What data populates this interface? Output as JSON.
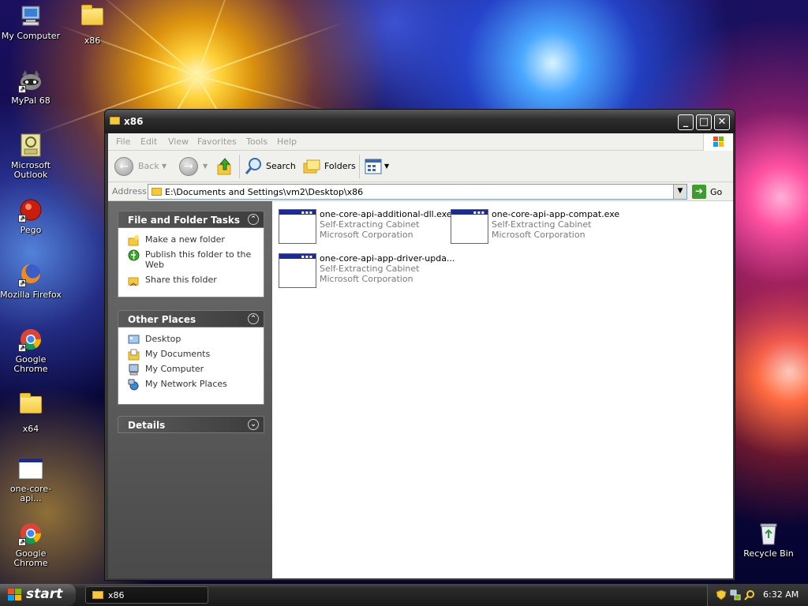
{
  "desktop": {
    "icons": [
      {
        "label": "My Computer"
      },
      {
        "label": "x86"
      },
      {
        "label": "MyPal 68"
      },
      {
        "label": "Microsoft Outlook"
      },
      {
        "label": "Pego"
      },
      {
        "label": "Mozilla Firefox"
      },
      {
        "label": "Google Chrome"
      },
      {
        "label": "x64"
      },
      {
        "label": "one-core-api..."
      },
      {
        "label": "Google Chrome"
      },
      {
        "label": "Recycle Bin"
      }
    ]
  },
  "window": {
    "title": "x86",
    "controls": {
      "minimize": "_",
      "maximize": "□",
      "close": "✕"
    },
    "menu": [
      "File",
      "Edit",
      "View",
      "Favorites",
      "Tools",
      "Help"
    ],
    "toolbar": {
      "back": "Back",
      "search": "Search",
      "folders": "Folders"
    },
    "address": {
      "label": "Address",
      "value": "E:\\Documents and Settings\\vm2\\Desktop\\x86",
      "go": "Go"
    },
    "taskpane": {
      "file_tasks": {
        "title": "File and Folder Tasks",
        "items": [
          "Make a new folder",
          "Publish this folder to the Web",
          "Share this folder"
        ]
      },
      "other_places": {
        "title": "Other Places",
        "items": [
          "Desktop",
          "My Documents",
          "My Computer",
          "My Network Places"
        ]
      },
      "details": {
        "title": "Details"
      }
    },
    "files": [
      {
        "name": "one-core-api-additional-dll.exe",
        "type": "Self-Extracting Cabinet",
        "company": "Microsoft Corporation"
      },
      {
        "name": "one-core-api-app-compat.exe",
        "type": "Self-Extracting Cabinet",
        "company": "Microsoft Corporation"
      },
      {
        "name": "one-core-api-app-driver-upda...",
        "type": "Self-Extracting Cabinet",
        "company": "Microsoft Corporation"
      }
    ]
  },
  "taskbar": {
    "start": "start",
    "tasks": [
      {
        "label": "x86"
      }
    ],
    "clock": "6:32 AM"
  },
  "colors": {
    "titlebar": "#1c1c1c",
    "selection_blue": "#1a2a9a",
    "folder_yellow": "#f4c93a",
    "go_green": "#3c9c2c"
  }
}
